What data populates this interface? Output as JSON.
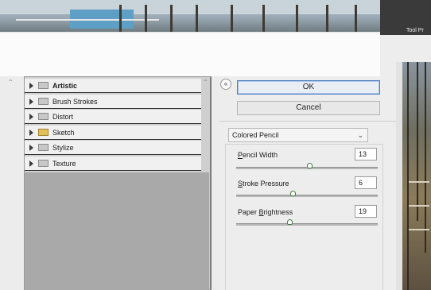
{
  "app": {
    "tool_panel_label": "Tool Pr"
  },
  "filter_tree": {
    "categories": [
      {
        "label": "Artistic",
        "expanded": false,
        "selected": true
      },
      {
        "label": "Brush Strokes",
        "expanded": false,
        "selected": false
      },
      {
        "label": "Distort",
        "expanded": false,
        "selected": false
      },
      {
        "label": "Sketch",
        "expanded": false,
        "selected": false
      },
      {
        "label": "Stylize",
        "expanded": false,
        "selected": false
      },
      {
        "label": "Texture",
        "expanded": false,
        "selected": false
      }
    ],
    "scroll_up_glyph": "⌃"
  },
  "controls": {
    "collapse_glyph": "«",
    "ok_label": "OK",
    "cancel_label": "Cancel",
    "filter_selected": "Colored Pencil",
    "chevron_glyph": "⌄"
  },
  "params": {
    "pencil_width": {
      "prefix": "",
      "underlined": "P",
      "suffix": "encil Width",
      "value": "13",
      "slider_fraction": 0.52
    },
    "stroke_pressure": {
      "prefix": "",
      "underlined": "S",
      "suffix": "troke Pressure",
      "value": "6",
      "slider_fraction": 0.4
    },
    "paper_brightness": {
      "prefix": "Paper ",
      "underlined": "B",
      "suffix": "rightness",
      "value": "19",
      "slider_fraction": 0.38
    }
  },
  "colors": {
    "ok_border": "#4a7cc1",
    "slider_thumb": "#3f7e3c",
    "folder_open": "#e3c057"
  }
}
